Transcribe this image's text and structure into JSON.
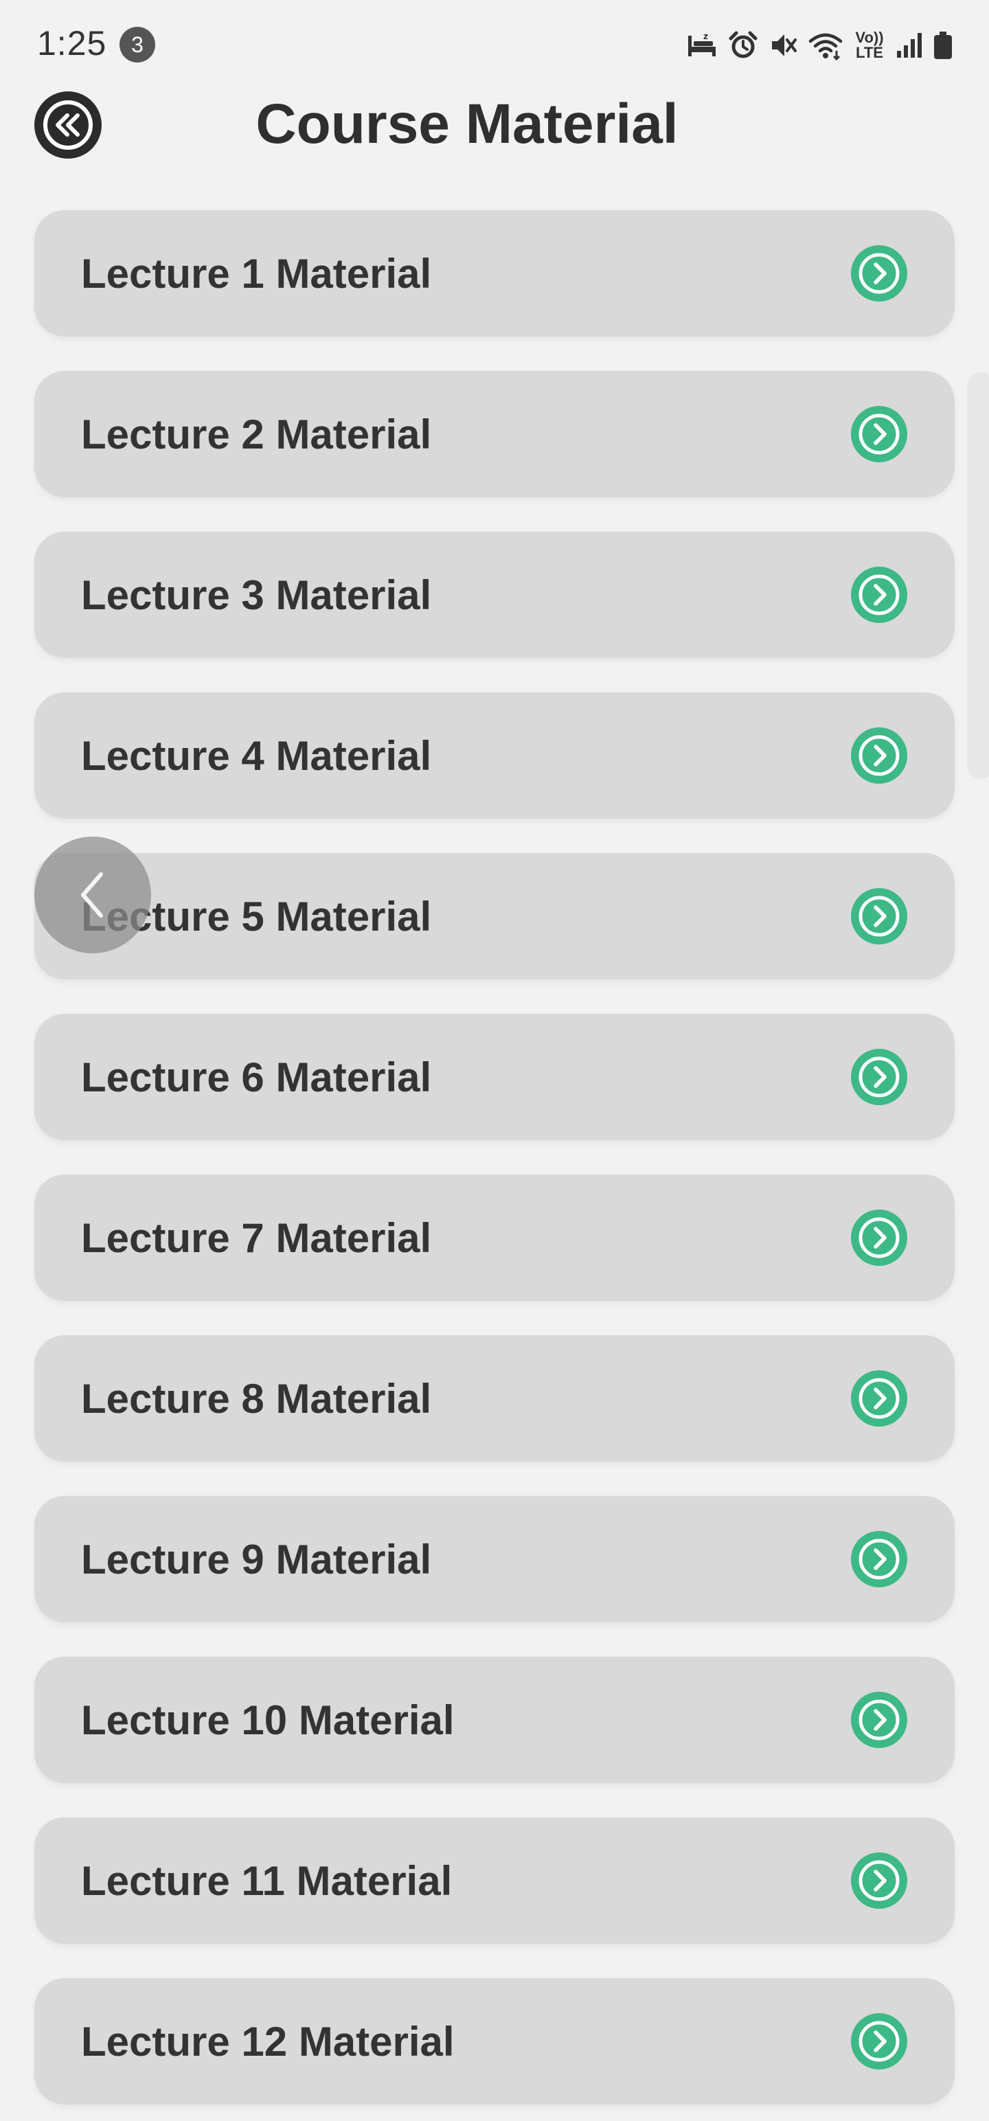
{
  "status_bar": {
    "time": "1:25",
    "notification_count": "3",
    "icons": [
      "sleep-icon",
      "alarm-icon",
      "mute-icon",
      "wifi-icon",
      "lte-icon",
      "signal-icon",
      "battery-icon"
    ],
    "lte_line1": "Vo))",
    "lte_line2": "LTE"
  },
  "header": {
    "title": "Course Material",
    "back_icon": "chevron-left-circle-icon"
  },
  "accent_color": "#3db887",
  "materials": [
    {
      "label": "Lecture 1 Material"
    },
    {
      "label": "Lecture 2 Material"
    },
    {
      "label": "Lecture 3 Material"
    },
    {
      "label": "Lecture 4 Material"
    },
    {
      "label": "Lecture 5 Material"
    },
    {
      "label": "Lecture 6 Material"
    },
    {
      "label": "Lecture 7 Material"
    },
    {
      "label": "Lecture 8 Material"
    },
    {
      "label": "Lecture 9 Material"
    },
    {
      "label": "Lecture 10 Material"
    },
    {
      "label": "Lecture 11 Material"
    },
    {
      "label": "Lecture 12 Material"
    }
  ]
}
